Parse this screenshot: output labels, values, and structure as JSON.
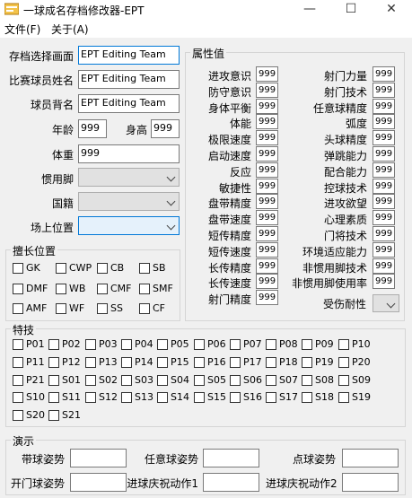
{
  "window": {
    "title": "一球成名存档修改器-EPT",
    "minimize": "—",
    "maximize": "☐",
    "close": "✕"
  },
  "menu": [
    "文件(F)",
    "关于(A)"
  ],
  "left": {
    "save_screen": {
      "label": "存档选择画面",
      "value": "EPT Editing Team"
    },
    "player_name": {
      "label": "比赛球员姓名",
      "value": "EPT Editing Team"
    },
    "back_name": {
      "label": "球员背名",
      "value": "EPT Editing Team"
    },
    "age": {
      "label": "年龄",
      "value": "999"
    },
    "height": {
      "label": "身高",
      "value": "999"
    },
    "weight": {
      "label": "体重",
      "value": "999"
    },
    "foot": {
      "label": "惯用脚",
      "value": ""
    },
    "nationality": {
      "label": "国籍",
      "value": ""
    },
    "position": {
      "label": "场上位置",
      "value": ""
    }
  },
  "positions": {
    "title": "擅长位置",
    "items": [
      "GK",
      "CWP",
      "CB",
      "SB",
      "DMF",
      "WB",
      "CMF",
      "SMF",
      "AMF",
      "WF",
      "SS",
      "CF"
    ]
  },
  "attributes": {
    "title": "属性值",
    "left": [
      {
        "label": "进攻意识",
        "value": "999"
      },
      {
        "label": "防守意识",
        "value": "999"
      },
      {
        "label": "身体平衡",
        "value": "999"
      },
      {
        "label": "体能",
        "value": "999"
      },
      {
        "label": "极限速度",
        "value": "999"
      },
      {
        "label": "启动速度",
        "value": "999"
      },
      {
        "label": "反应",
        "value": "999"
      },
      {
        "label": "敏捷性",
        "value": "999"
      },
      {
        "label": "盘带精度",
        "value": "999"
      },
      {
        "label": "盘带速度",
        "value": "999"
      },
      {
        "label": "短传精度",
        "value": "999"
      },
      {
        "label": "短传速度",
        "value": "999"
      },
      {
        "label": "长传精度",
        "value": "999"
      },
      {
        "label": "长传速度",
        "value": "999"
      },
      {
        "label": "射门精度",
        "value": "999"
      }
    ],
    "right": [
      {
        "label": "射门力量",
        "value": "999"
      },
      {
        "label": "射门技术",
        "value": "999"
      },
      {
        "label": "任意球精度",
        "value": "999"
      },
      {
        "label": "弧度",
        "value": "999"
      },
      {
        "label": "头球精度",
        "value": "999"
      },
      {
        "label": "弹跳能力",
        "value": "999"
      },
      {
        "label": "配合能力",
        "value": "999"
      },
      {
        "label": "控球技术",
        "value": "999"
      },
      {
        "label": "进攻欲望",
        "value": "999"
      },
      {
        "label": "心理素质",
        "value": "999"
      },
      {
        "label": "门将技术",
        "value": "999"
      },
      {
        "label": "环境适应能力",
        "value": "999"
      },
      {
        "label": "非惯用脚技术",
        "value": "999"
      },
      {
        "label": "非惯用脚使用率",
        "value": "999"
      }
    ],
    "injury": {
      "label": "受伤耐性",
      "value": ""
    }
  },
  "skills": {
    "title": "特技",
    "items": [
      "P01",
      "P02",
      "P03",
      "P04",
      "P05",
      "P06",
      "P07",
      "P08",
      "P09",
      "P10",
      "P11",
      "P12",
      "P13",
      "P14",
      "P15",
      "P16",
      "P17",
      "P18",
      "P19",
      "P20",
      "P21",
      "S01",
      "S02",
      "S03",
      "S04",
      "S05",
      "S06",
      "S07",
      "S08",
      "S09",
      "S10",
      "S11",
      "S12",
      "S13",
      "S14",
      "S15",
      "S16",
      "S17",
      "S18",
      "S19",
      "S20",
      "S21"
    ]
  },
  "demo": {
    "title": "演示",
    "fields": [
      {
        "label": "带球姿势",
        "value": ""
      },
      {
        "label": "任意球姿势",
        "value": ""
      },
      {
        "label": "点球姿势",
        "value": ""
      },
      {
        "label": "开门球姿势",
        "value": ""
      },
      {
        "label": "进球庆祝动作1",
        "value": ""
      },
      {
        "label": "进球庆祝动作2",
        "value": ""
      }
    ]
  }
}
